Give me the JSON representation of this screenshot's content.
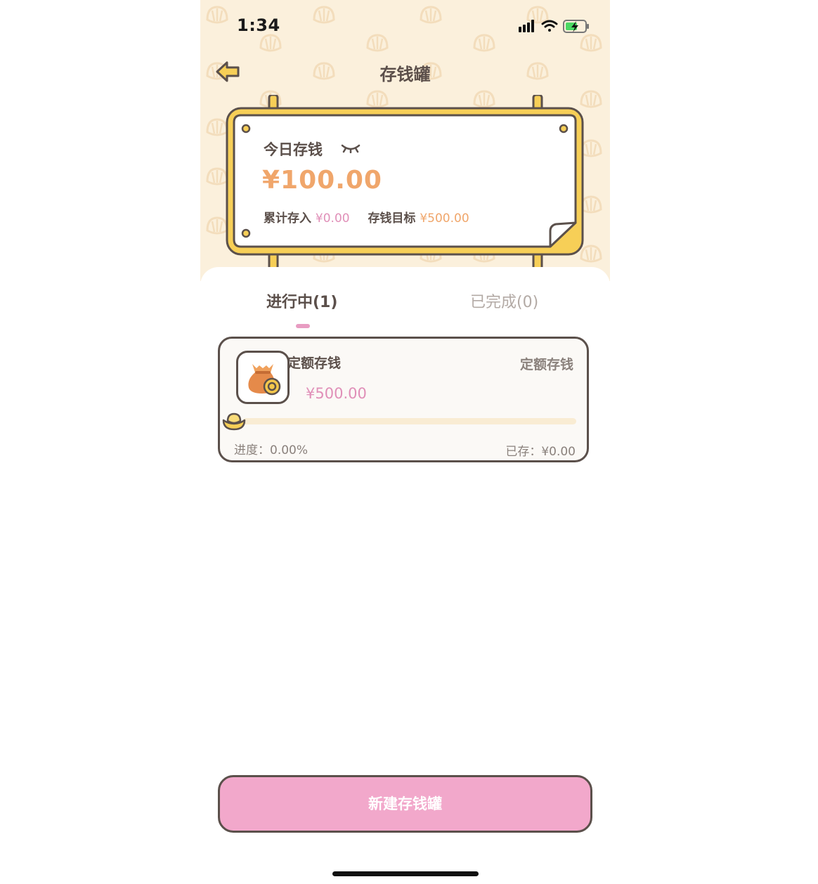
{
  "status_bar": {
    "time": "1:34"
  },
  "header": {
    "title": "存钱罐"
  },
  "summary": {
    "today_label": "今日存钱",
    "today_amount": "¥100.00",
    "total_label": "累计存入",
    "total_value": "¥0.00",
    "goal_label": "存钱目标",
    "goal_value": "¥500.00"
  },
  "tabs": [
    {
      "label": "进行中(1)",
      "active": true
    },
    {
      "label": "已完成(0)",
      "active": false
    }
  ],
  "jars": [
    {
      "name": "定额存钱",
      "type": "定额存钱",
      "target": "¥500.00",
      "progress_text": "进度：0.00%",
      "progress_fraction": 0.0,
      "saved_text": "已存：¥0.00"
    }
  ],
  "actions": {
    "new_jar_label": "新建存钱罐"
  },
  "icons": {
    "back": "back-arrow-icon",
    "eye": "eye-closed-icon",
    "jar": "money-bag-icon",
    "progress": "gold-ingot-icon"
  },
  "colors": {
    "background": "#fbf0dc",
    "sign_border": "#f7cf57",
    "accent_pink": "#e08fb8",
    "accent_orange": "#f0a66b",
    "button_pink": "#f2a8cb"
  }
}
